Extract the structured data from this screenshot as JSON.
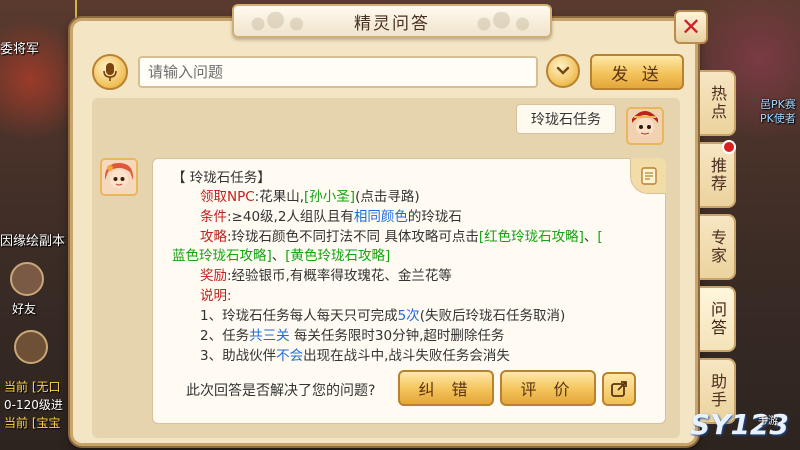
{
  "dialog": {
    "title": "精灵问答",
    "close_symbol": "✕"
  },
  "input": {
    "placeholder": "请输入问题",
    "send_label": "发 送",
    "dropdown_symbol": "⌄"
  },
  "user_message": "玲珑石任务",
  "answer": {
    "heading": "【 玲珑石任务】",
    "npc_label": "领取NPC",
    "npc_value_pre": ":花果山,",
    "npc_link": "[孙小圣]",
    "npc_value_post": "(点击寻路)",
    "cond_label": "条件",
    "cond_pre": ":≥40级,2人组队且有",
    "cond_link": "相同颜色",
    "cond_post": "的玲珑石",
    "strategy_label": "攻略",
    "strategy_pre": ":玲珑石颜色不同打法不同 具体攻略可点击",
    "strategy_link_red": "[红色玲珑石攻略]",
    "strategy_sep1": "、",
    "strategy_link_bracket": "[",
    "strategy_link_blue": "蓝色玲珑石攻略]",
    "strategy_sep2": "、",
    "strategy_link_yellow": "[黄色玲珑石攻略]",
    "reward_label": "奖励",
    "reward_value": ":经验银币,有概率得玫瑰花、金兰花等",
    "note_label": "说明",
    "note_colon": ":",
    "note1_pre": "1、玲珑石任务每人每天只可完成",
    "note1_hl": "5次",
    "note1_post": "(失败后玲珑石任务取消)",
    "note2_pre": "2、任务",
    "note2_hl": "共三关",
    "note2_post": " 每关任务限时30分钟,超时删除任务",
    "note3_pre": "3、助战伙伴",
    "note3_hl": "不会",
    "note3_post": "出现在战斗中,战斗失败任务会消失"
  },
  "feedback": {
    "question": "此次回答是否解决了您的问题?",
    "correct_label": "纠 错",
    "rate_label": "评 价"
  },
  "side_tabs": [
    "热点",
    "推荐",
    "专家",
    "问答",
    "助手"
  ],
  "background": {
    "top_left": "委将军",
    "mid_left": "因缘绘副本",
    "friend": "好友",
    "right_top1": "邑PK赛",
    "right_top2": "PK使者",
    "chat1_tag": "当前",
    "chat1_text": "[无口",
    "chat2_text": "0-120级进",
    "chat3_tag": "当前",
    "chat3_text": "[宝宝"
  },
  "watermark": {
    "main": "SY123",
    "sub": "手游"
  },
  "colors": {
    "label_red": "#c0211f",
    "link_green": "#13a313",
    "highlight_blue": "#1f6bd6",
    "panel": "#f4e6c4",
    "button_gold": "#f3c35a"
  },
  "icons": [
    "microphone-icon",
    "chevron-down-icon",
    "close-icon",
    "scroll-icon",
    "share-icon"
  ]
}
